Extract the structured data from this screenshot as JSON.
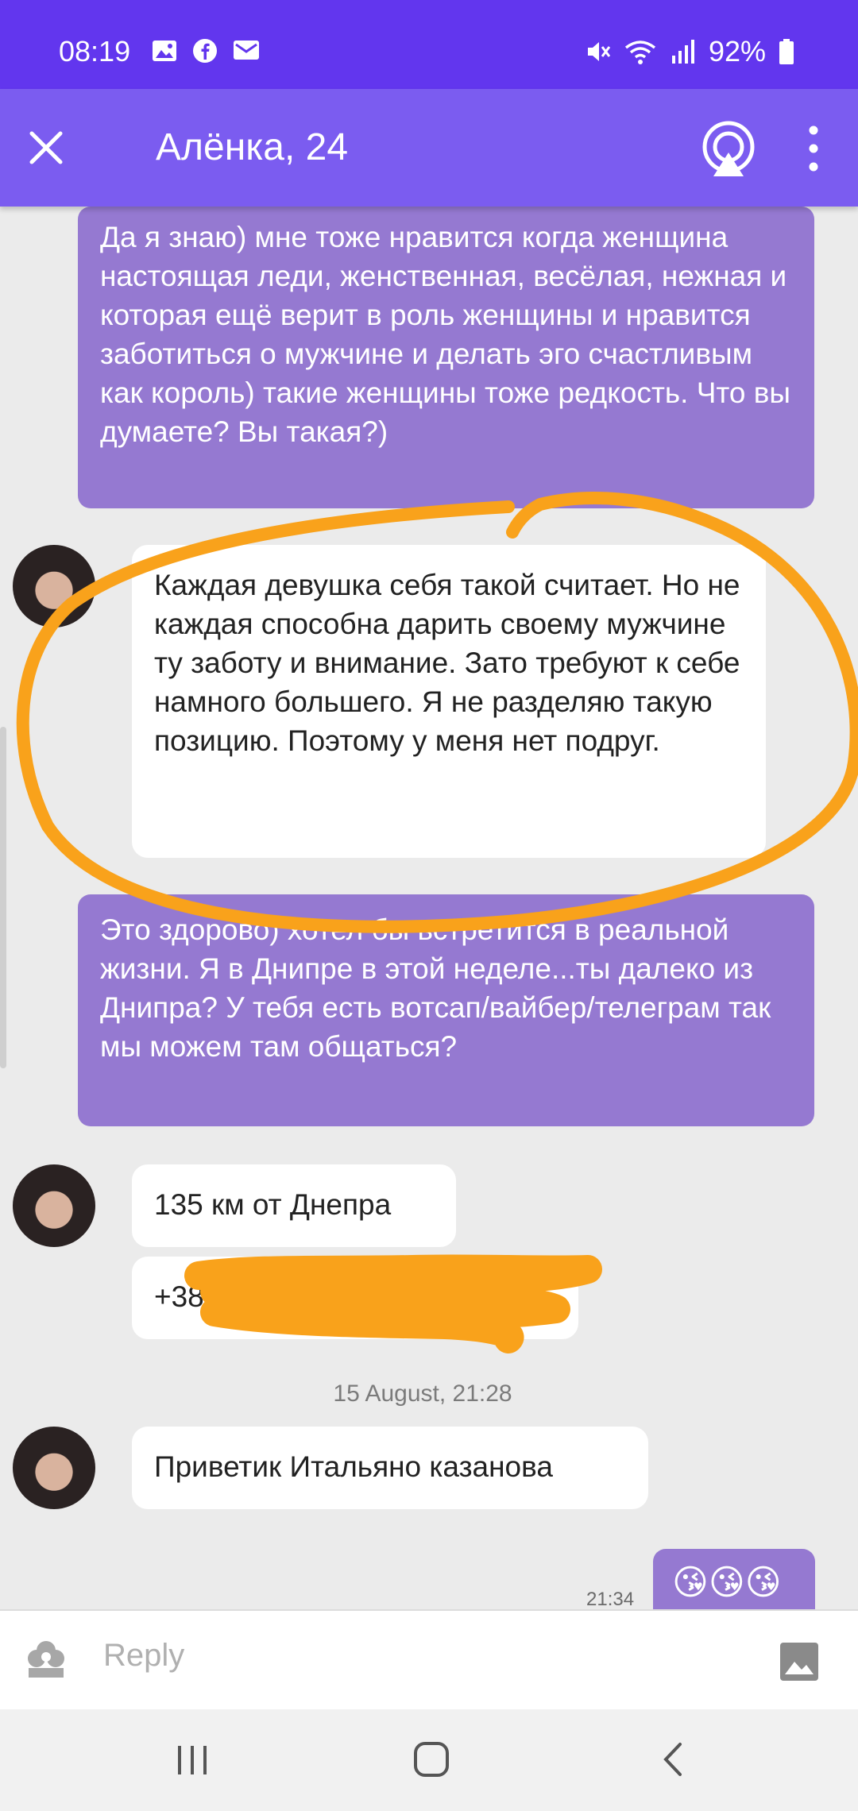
{
  "status_bar": {
    "time": "08:19",
    "battery": "92%",
    "icons": [
      "gallery-icon",
      "facebook-icon",
      "mail-icon",
      "mute-icon",
      "wifi-icon",
      "signal-icon",
      "battery-icon"
    ]
  },
  "header": {
    "title": "Алёнка, 24",
    "colors": {
      "status_bar": "#6236ee",
      "app_bar": "#7b5cf0"
    }
  },
  "messages": [
    {
      "direction": "out",
      "text": "Да я знаю) мне тоже нравится когда женщина настоящая леди, женственная, весёлая, нежная и которая ещё верит в роль женщины и нравится заботиться о мужчине и делать эго счастливым как король) такие женщины тоже редкость. Что вы думаете? Вы такая?)"
    },
    {
      "direction": "in",
      "text": "Каждая девушка себя такой считает. Но не каждая способна дарить своему мужчине ту заботу и внимание. Зато требуют к себе намного большего. Я не разделяю такую позицию. Поэтому у меня нет подруг."
    },
    {
      "direction": "out",
      "text": "Это здорово) хотел бы встретится в реальной жизни. Я в Днипре в этой неделе...ты далеко из Днипра? У тебя есть вотсап/вайбер/телеграм так мы можем там общаться?"
    },
    {
      "direction": "in",
      "text": "135 км от Днепра"
    },
    {
      "direction": "in",
      "text": "+380"
    },
    {
      "direction": "in",
      "text": "Приветик Итальяно казанова"
    },
    {
      "direction": "out",
      "text": "😘😘😘",
      "time": "21:34"
    }
  ],
  "date_separator": "15 August, 21:28",
  "composer": {
    "placeholder": "Reply"
  },
  "colors": {
    "outgoing_bubble": "#9579d1",
    "incoming_bubble": "#ffffff",
    "annotation": "#f9a21b"
  }
}
